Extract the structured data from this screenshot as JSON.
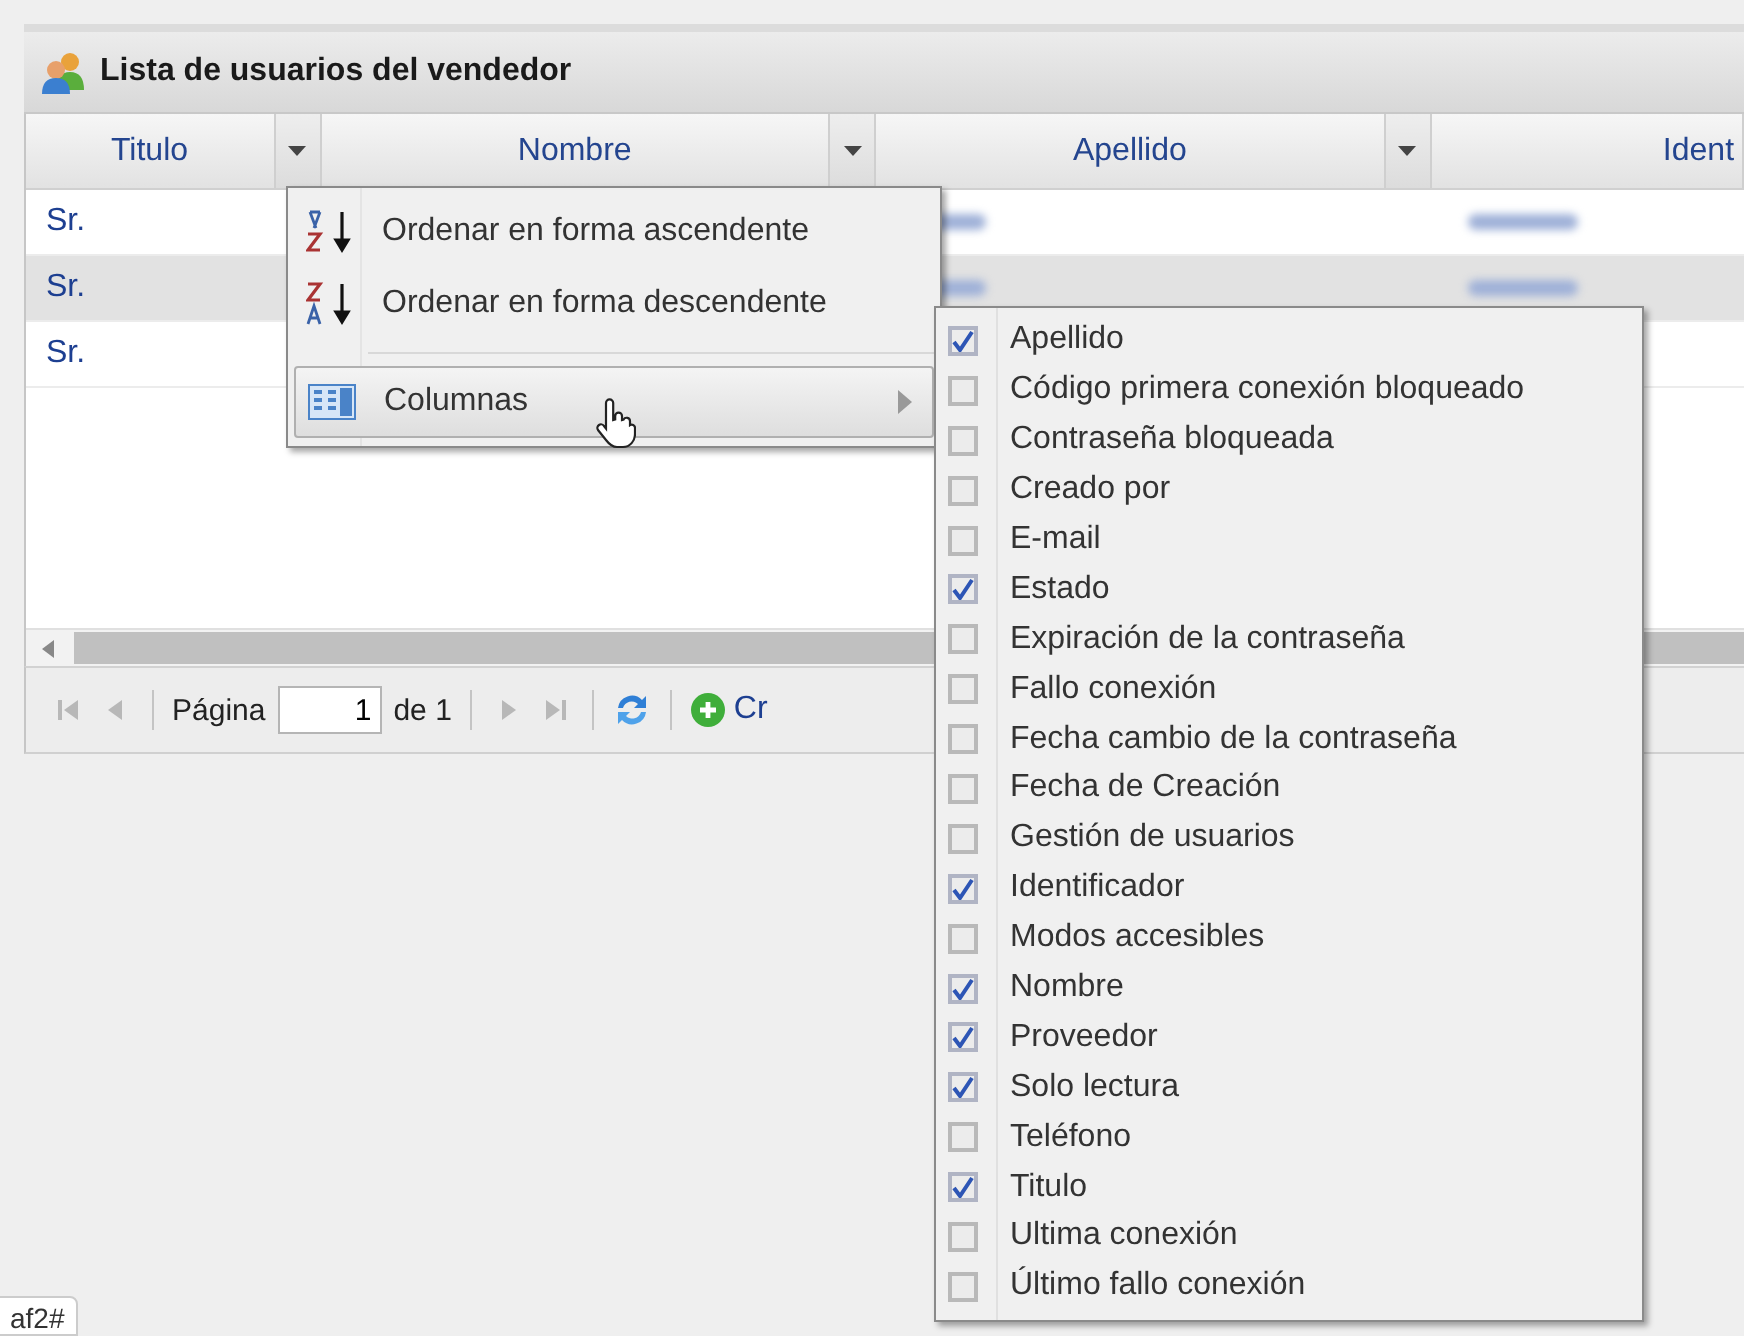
{
  "panel": {
    "title": "Lista de usuarios del vendedor"
  },
  "columns": [
    {
      "label": "Titulo"
    },
    {
      "label": "Nombre"
    },
    {
      "label": "Apellido"
    },
    {
      "label": "Ident"
    }
  ],
  "rows": [
    {
      "selected": false,
      "titulo": "Sr.",
      "apellido": {
        "kind": "blurred"
      },
      "ident": {
        "kind": "blurred"
      }
    },
    {
      "selected": true,
      "titulo": "Sr.",
      "apellido": {
        "kind": "blurred"
      },
      "ident": {
        "kind": "blurred"
      }
    },
    {
      "selected": false,
      "titulo": "Sr."
    }
  ],
  "pager": {
    "page_label": "Página",
    "page_value": "1",
    "of_label": "de 1",
    "create_label": "Cr"
  },
  "column_menu": {
    "items": [
      {
        "kind": "sort-asc",
        "label": "Ordenar en forma ascendente",
        "highlighted": false
      },
      {
        "kind": "sort-desc",
        "label": "Ordenar en forma descendente",
        "highlighted": false
      },
      {
        "kind": "separator"
      },
      {
        "kind": "columns",
        "label": "Columnas",
        "highlighted": true
      }
    ]
  },
  "columns_submenu": {
    "items": [
      {
        "label": "Apellido",
        "checked": true
      },
      {
        "label": "Código primera conexión bloqueado",
        "checked": false
      },
      {
        "label": "Contraseña bloqueada",
        "checked": false
      },
      {
        "label": "Creado por",
        "checked": false
      },
      {
        "label": "E-mail",
        "checked": false
      },
      {
        "label": "Estado",
        "checked": true
      },
      {
        "label": "Expiración de la contraseña",
        "checked": false
      },
      {
        "label": "Fallo conexión",
        "checked": false
      },
      {
        "label": "Fecha cambio de la contraseña",
        "checked": false
      },
      {
        "label": "Fecha de Creación",
        "checked": false
      },
      {
        "label": "Gestión de usuarios",
        "checked": false
      },
      {
        "label": "Identificador",
        "checked": true
      },
      {
        "label": "Modos accesibles",
        "checked": false
      },
      {
        "label": "Nombre",
        "checked": true
      },
      {
        "label": "Proveedor",
        "checked": true
      },
      {
        "label": "Solo lectura",
        "checked": true
      },
      {
        "label": "Teléfono",
        "checked": false
      },
      {
        "label": "Titulo",
        "checked": true
      },
      {
        "label": "Ultima conexión",
        "checked": false
      },
      {
        "label": "Último fallo conexión",
        "checked": false
      }
    ]
  },
  "status_tab": {
    "text": "af2#"
  }
}
